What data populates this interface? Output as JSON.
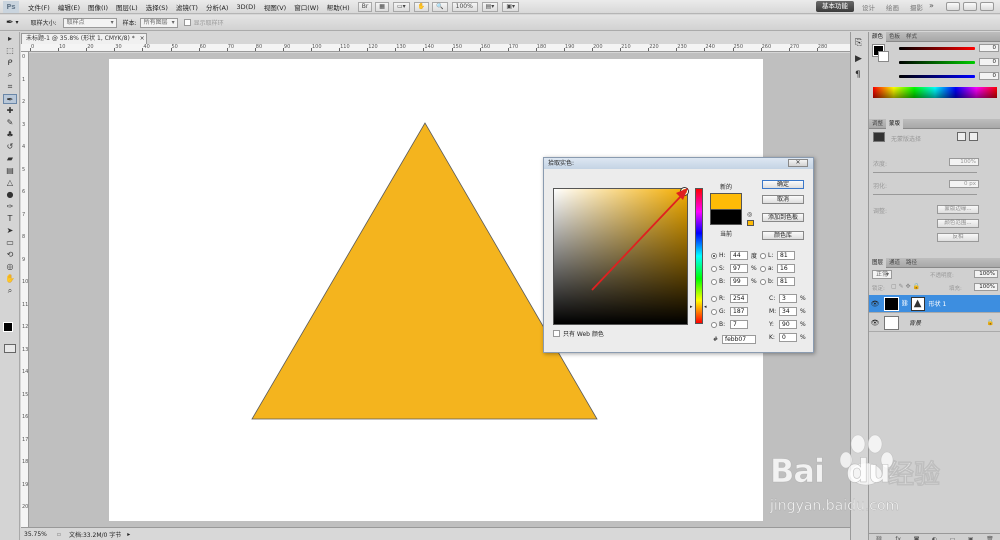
{
  "app": {
    "logo": "Ps",
    "menu": [
      "文件(F)",
      "编辑(E)",
      "图像(I)",
      "图层(L)",
      "选择(S)",
      "滤镜(T)",
      "分析(A)",
      "3D(D)",
      "视图(V)",
      "窗口(W)",
      "帮助(H)"
    ],
    "zoom_box": "100%",
    "workspaces": {
      "active": "基本功能",
      "others": [
        "设计",
        "绘画",
        "摄影"
      ]
    }
  },
  "options": {
    "sample_size_label": "取样大小:",
    "sample_size_value": "取样点",
    "sample_label": "样本:",
    "sample_value": "所有图层",
    "show_ring_label": "显示取样环"
  },
  "document": {
    "tab_title": "未标题-1 @ 35.8% (形状 1, CMYK/8) *",
    "ruler_top": [
      "0",
      "10",
      "20",
      "30",
      "40",
      "50",
      "60",
      "70",
      "80",
      "90",
      "100",
      "110",
      "120",
      "130",
      "140",
      "150",
      "160",
      "170",
      "180",
      "190",
      "200",
      "210",
      "220",
      "230",
      "240",
      "250",
      "260",
      "270",
      "280"
    ],
    "ruler_left": [
      "0",
      "1",
      "2",
      "3",
      "4",
      "5",
      "6",
      "7",
      "8",
      "9",
      "10",
      "11",
      "12",
      "13",
      "14",
      "15",
      "16",
      "17",
      "18",
      "19",
      "20"
    ],
    "triangle_color": "#f4b41e"
  },
  "status": {
    "zoom": "35.75%",
    "doc_size": "文档:33.2M/0 字节"
  },
  "color_panel": {
    "tabs": [
      "颜色",
      "色板",
      "样式"
    ],
    "values": [
      "0",
      "0",
      "0"
    ]
  },
  "adjust_panel": {
    "tabs": [
      "调整",
      "蒙版"
    ],
    "heading": "无蒙版选择",
    "density_label": "浓度:",
    "density_value": "100%",
    "feather_label": "羽化:",
    "feather_value": "0 px",
    "refine_label": "调整:",
    "buttons": [
      "蒙版边缘...",
      "颜色范围...",
      "反相"
    ]
  },
  "layers_panel": {
    "tabs": [
      "图层",
      "通道",
      "路径"
    ],
    "blend_mode": "正常",
    "opacity_label": "不透明度:",
    "opacity_value": "100%",
    "lock_label": "锁定:",
    "fill_label": "填充:",
    "fill_value": "100%",
    "layers": [
      {
        "name": "形状 1",
        "selected": true
      },
      {
        "name": "背景",
        "selected": false
      }
    ]
  },
  "dialog": {
    "title": "拾取实色:",
    "close": "✕",
    "new_label": "新的",
    "current_label": "当前",
    "new_color": "#febb07",
    "current_color": "#000000",
    "buttons": {
      "ok": "确定",
      "cancel": "取消",
      "add_swatch": "添加到色板",
      "libraries": "颜色库"
    },
    "web_only_label": "只有 Web 颜色",
    "fields": {
      "H": {
        "label": "H:",
        "value": "44",
        "unit": "度"
      },
      "S": {
        "label": "S:",
        "value": "97",
        "unit": "%"
      },
      "B": {
        "label": "B:",
        "value": "99",
        "unit": "%"
      },
      "R": {
        "label": "R:",
        "value": "254"
      },
      "G": {
        "label": "G:",
        "value": "187"
      },
      "Bl": {
        "label": "B:",
        "value": "7"
      },
      "L": {
        "label": "L:",
        "value": "81"
      },
      "a": {
        "label": "a:",
        "value": "16"
      },
      "b": {
        "label": "b:",
        "value": "81"
      },
      "C": {
        "label": "C:",
        "value": "3",
        "unit": "%"
      },
      "M": {
        "label": "M:",
        "value": "34",
        "unit": "%"
      },
      "Y": {
        "label": "Y:",
        "value": "90",
        "unit": "%"
      },
      "K": {
        "label": "K:",
        "value": "0",
        "unit": "%"
      }
    },
    "hex_label": "#",
    "hex_value": "febb07",
    "arrow_color": "#e02020"
  },
  "watermark": {
    "brand": "Bai",
    "brand_suffix": "du",
    "cn": "经验",
    "url": "jingyan.baidu.com"
  }
}
